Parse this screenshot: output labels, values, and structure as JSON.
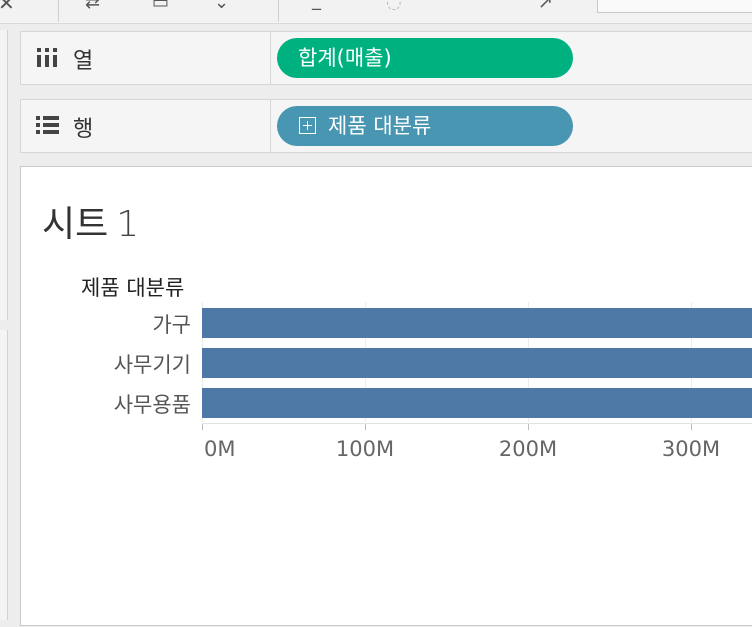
{
  "toolbar": {
    "icons": [
      "close-icon",
      "swap-icon",
      "sort-ascending-icon",
      "sort-descending-icon",
      "highlight-icon",
      "attach-icon",
      "fit-icon",
      "pin-icon"
    ]
  },
  "shelves": {
    "columns": {
      "label": "열",
      "pill": "합계(매출)",
      "color": "#00b180"
    },
    "rows": {
      "label": "행",
      "pill": "제품 대분류",
      "color": "#4996b2"
    }
  },
  "sheet": {
    "title": "시트",
    "title_number": "1"
  },
  "chart_data": {
    "type": "bar",
    "orientation": "horizontal",
    "row_header": "제품 대분류",
    "categories": [
      "가구",
      "사무기기",
      "사무용품"
    ],
    "values": [
      340000000,
      340000000,
      340000000
    ],
    "xticks": [
      "0M",
      "100M",
      "200M",
      "300M"
    ],
    "xtick_values": [
      0,
      100000000,
      200000000,
      300000000
    ],
    "xlim": [
      0,
      335000000
    ],
    "bar_color": "#4e79a7",
    "grid": true
  }
}
